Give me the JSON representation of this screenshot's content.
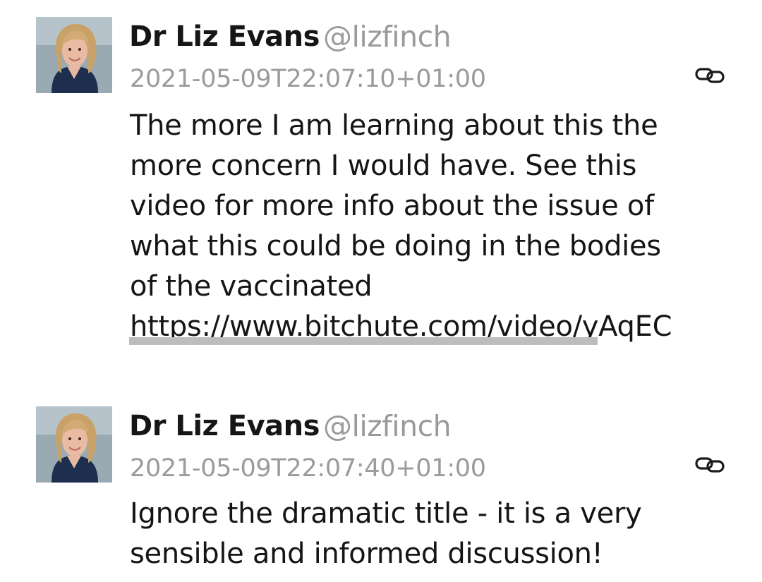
{
  "posts": [
    {
      "author_name": "Dr Liz Evans",
      "author_handle": "@lizfinch",
      "timestamp": "2021-05-09T22:07:10+01:00",
      "link_icon": "link-icon",
      "lines": [
        "The more I am learning about this the",
        "more concern I would have.  See this",
        "video for more info about the issue of",
        "what this could be doing in the bodies",
        "of the vaccinated"
      ],
      "url": "https://www.bitchute.com/video/yAqEC"
    },
    {
      "author_name": "Dr Liz Evans",
      "author_handle": "@lizfinch",
      "timestamp": "2021-05-09T22:07:40+01:00",
      "link_icon": "link-icon",
      "lines": [
        "Ignore the dramatic title - it is a very",
        "sensible and informed discussion!"
      ]
    }
  ],
  "colors": {
    "name": "#161616",
    "handle": "#9a9a9a",
    "timestamp": "#9b9b9b",
    "text": "#151515",
    "link_underline": "#bdbdbd"
  }
}
